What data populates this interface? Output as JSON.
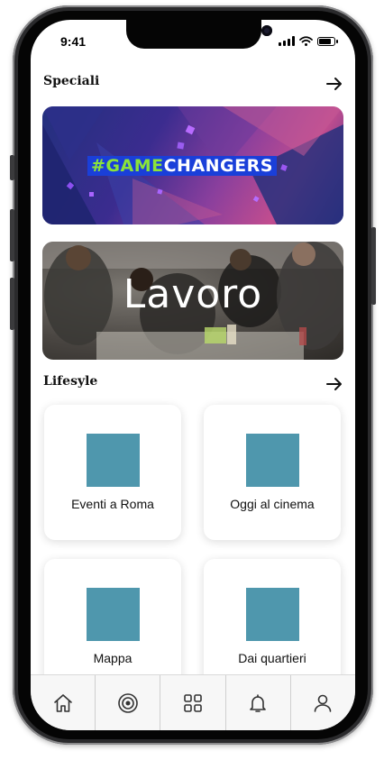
{
  "status_bar": {
    "time": "9:41",
    "icons": [
      "signal-icon",
      "wifi-icon",
      "battery-icon"
    ]
  },
  "sections": {
    "speciali": {
      "title": "Speciali",
      "arrow_icon": "arrow-right-icon"
    },
    "lifestyle": {
      "title": "Lifesyle",
      "arrow_icon": "arrow-right-icon"
    }
  },
  "banners": {
    "gamechangers": {
      "text_hash": "#GAME",
      "text_rest": "CHANGERS"
    },
    "lavoro": {
      "title": "Lavoro"
    }
  },
  "cards": [
    {
      "label": "Eventi a Roma"
    },
    {
      "label": "Oggi al cinema"
    },
    {
      "label": "Mappa"
    },
    {
      "label": "Dai quartieri"
    }
  ],
  "bottom_nav": [
    "home-icon",
    "target-icon",
    "grid-icon",
    "bell-icon",
    "user-icon"
  ],
  "colors": {
    "card_placeholder": "#4f97ad",
    "gamechangers_green": "#8be33a",
    "gamechangers_blue": "#1a3fd9"
  }
}
